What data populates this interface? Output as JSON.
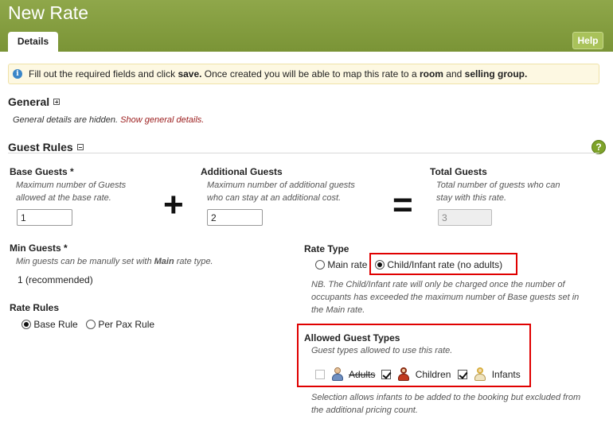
{
  "header": {
    "title": "New Rate",
    "tab_details": "Details",
    "help_label": "Help"
  },
  "info": {
    "icon": "info-icon",
    "text_1": "Fill out the required fields and click ",
    "save": "save.",
    "text_2": " Once created you will be able to map this rate to a ",
    "room": "room",
    "text_3": " and ",
    "selling_group": "selling group."
  },
  "general": {
    "title": "General",
    "hidden_text": "General details are hidden. ",
    "show_link": "Show general details."
  },
  "guest_rules": {
    "title": "Guest Rules",
    "base_guests": {
      "label": "Base Guests *",
      "desc_1": "Maximum number of Guests",
      "desc_2": "allowed at the base rate.",
      "value": "1"
    },
    "plus": "+",
    "additional_guests": {
      "label": "Additional Guests",
      "desc_1": "Maximum number of additional guests",
      "desc_2": "who can stay at an additional cost.",
      "value": "2"
    },
    "equals": "=",
    "total_guests": {
      "label": "Total Guests",
      "desc_1": "Total number of guests who can",
      "desc_2": "stay with this rate.",
      "value": "3"
    },
    "min_guests": {
      "label": "Min Guests *",
      "desc_pre": "Min guests can be manully set with ",
      "desc_bold": "Main",
      "desc_post": " rate type.",
      "value": "1 (recommended)"
    },
    "rate_rules": {
      "label": "Rate Rules",
      "options": [
        "Base Rule",
        "Per Pax Rule"
      ],
      "selected": "Base Rule"
    },
    "rate_type": {
      "label": "Rate Type",
      "options": [
        "Main rate",
        "Child/Infant rate (no adults)"
      ],
      "selected": "Child/Infant rate (no adults)",
      "note_1": "NB. The Child/Infant rate will only be charged once the number of",
      "note_2": "occupants has exceeded the maximum number of Base guests set in",
      "note_3": "the Main rate."
    },
    "allowed_guest_types": {
      "label": "Allowed Guest Types",
      "desc": "Guest types allowed to use this rate.",
      "types": [
        {
          "name": "Adults",
          "checked": false,
          "disabled": true,
          "icon": "adult-icon"
        },
        {
          "name": "Children",
          "checked": true,
          "disabled": false,
          "icon": "child-icon"
        },
        {
          "name": "Infants",
          "checked": true,
          "disabled": false,
          "icon": "infant-icon"
        }
      ],
      "note_1": "Selection allows infants to be added to the booking but excluded from",
      "note_2": "the additional pricing count."
    }
  },
  "colors": {
    "header_green": "#7f9a3b",
    "highlight_red": "#e00000",
    "link_red": "#9b1c1c",
    "info_bg": "#fdf8e2"
  }
}
